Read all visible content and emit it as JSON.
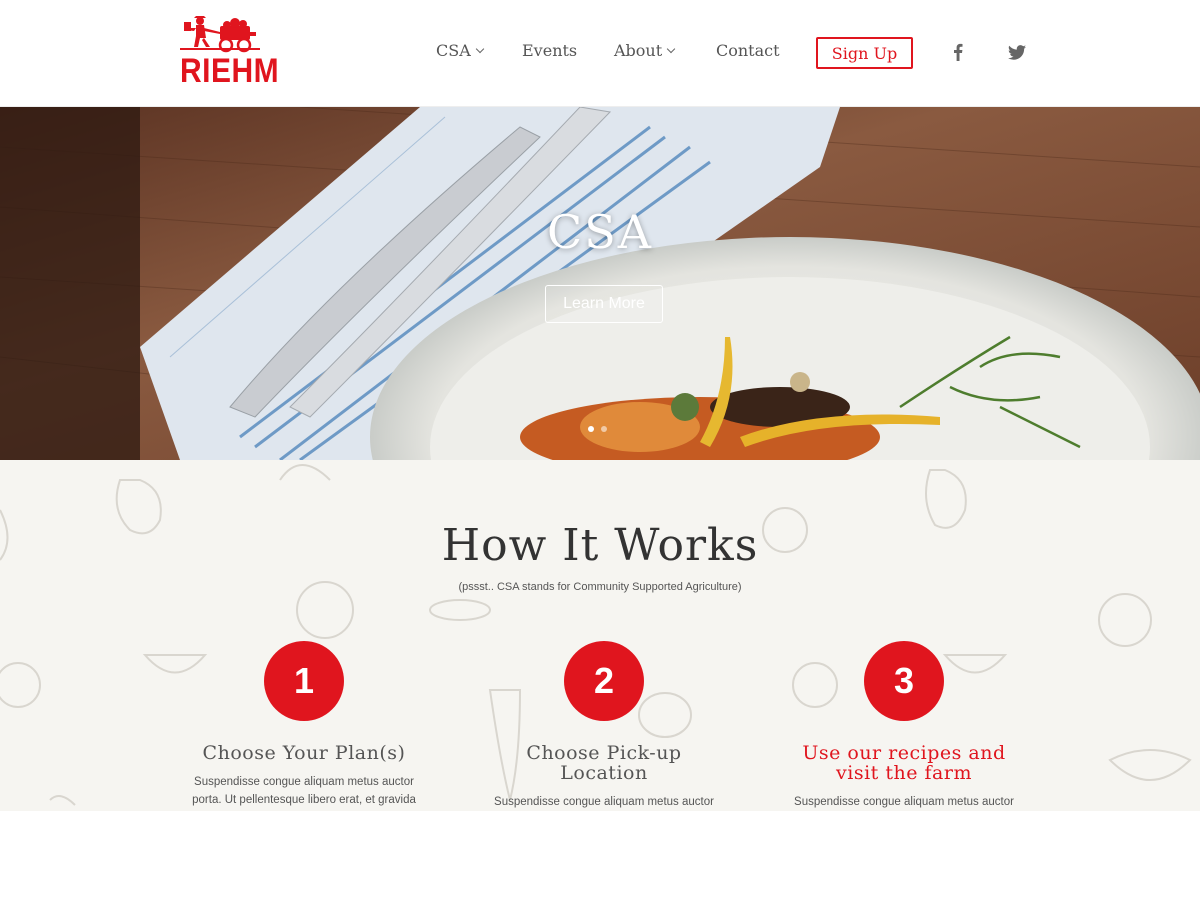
{
  "header": {
    "logo_text": "RIEHM",
    "nav": [
      {
        "label": "CSA",
        "dropdown": true
      },
      {
        "label": "Events",
        "dropdown": false
      },
      {
        "label": "About",
        "dropdown": true
      },
      {
        "label": "Contact",
        "dropdown": false
      }
    ],
    "signup_label": "Sign Up",
    "social": [
      "facebook-icon",
      "twitter-icon"
    ]
  },
  "hero": {
    "title": "CSA",
    "button_label": "Learn More",
    "slides": 2,
    "active_slide": 1
  },
  "how": {
    "title": "How It Works",
    "subtitle": "(pssst.. CSA stands for Community Supported Agriculture)",
    "steps": [
      {
        "number": "1",
        "title": "Choose Your Plan(s)",
        "description": "Suspendisse congue aliquam metus auctor porta. Ut pellentesque libero erat, et gravida"
      },
      {
        "number": "2",
        "title": "Choose Pick-up Location",
        "description": "Suspendisse congue aliquam metus auctor"
      },
      {
        "number": "3",
        "title": "Use our recipes and visit the farm",
        "description": "Suspendisse congue aliquam metus auctor"
      }
    ]
  },
  "colors": {
    "brand_red": "#e0151e",
    "section_bg": "#f6f5f1",
    "text": "#333333"
  }
}
